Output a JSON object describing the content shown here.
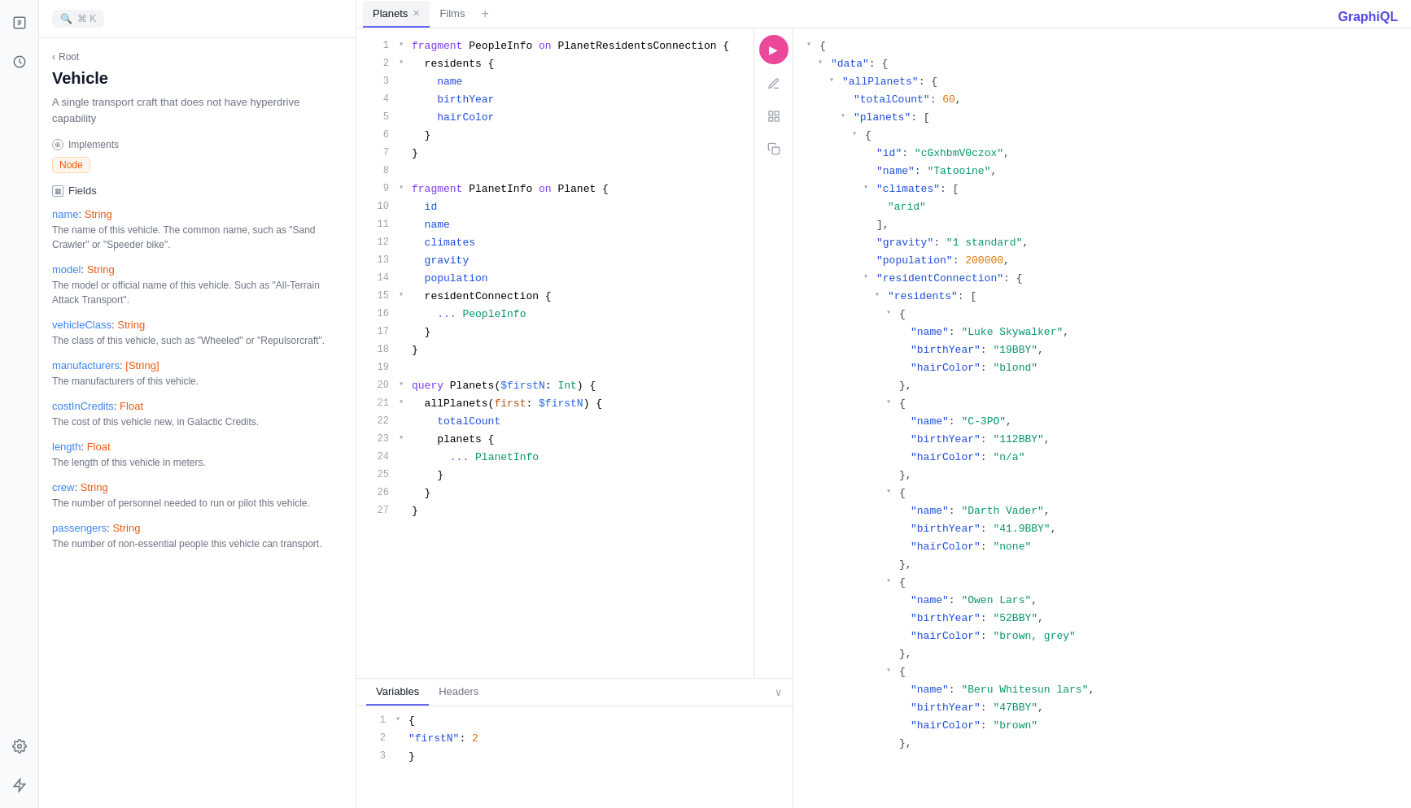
{
  "app": {
    "title": "GraphiQL"
  },
  "leftNav": {
    "icons": [
      "document",
      "history",
      "star",
      "settings"
    ]
  },
  "sidebar": {
    "breadcrumb": "Root",
    "title": "Vehicle",
    "description": "A single transport craft that does not have hyperdrive capability",
    "implements_label": "Implements",
    "search_kbd": "⌘ K",
    "tag": "Node",
    "fields_label": "Fields",
    "fields": [
      {
        "name": "name",
        "type": "String",
        "description": "The name of this vehicle. The common name, such as \"Sand Crawler\" or \"Speeder bike\"."
      },
      {
        "name": "model",
        "type": "String",
        "description": "The model or official name of this vehicle. Such as \"All-Terrain Attack Transport\"."
      },
      {
        "name": "vehicleClass",
        "type": "String",
        "description": "The class of this vehicle, such as \"Wheeled\" or \"Repulsorcraft\"."
      },
      {
        "name": "manufacturers",
        "type": "[String]",
        "description": "The manufacturers of this vehicle."
      },
      {
        "name": "costInCredits",
        "type": "Float",
        "description": "The cost of this vehicle new, in Galactic Credits."
      },
      {
        "name": "length",
        "type": "Float",
        "description": "The length of this vehicle in meters."
      },
      {
        "name": "crew",
        "type": "String",
        "description": "The number of personnel needed to run or pilot this vehicle."
      },
      {
        "name": "passengers",
        "type": "String",
        "description": "The number of non-essential people this vehicle can transport."
      }
    ]
  },
  "tabs": [
    {
      "label": "Planets",
      "active": true,
      "closeable": true
    },
    {
      "label": "Films",
      "active": false,
      "closeable": false
    }
  ],
  "editor": {
    "lines": [
      {
        "num": 1,
        "toggle": "▾",
        "content": "fragment PeopleInfo on PlanetResidentsConnection {",
        "type": "fragment_def"
      },
      {
        "num": 2,
        "toggle": "▾",
        "content": "  residents {",
        "type": "field_open"
      },
      {
        "num": 3,
        "toggle": "",
        "content": "    name",
        "type": "field"
      },
      {
        "num": 4,
        "toggle": "",
        "content": "    birthYear",
        "type": "field"
      },
      {
        "num": 5,
        "toggle": "",
        "content": "    hairColor",
        "type": "field"
      },
      {
        "num": 6,
        "toggle": "",
        "content": "  }",
        "type": "close"
      },
      {
        "num": 7,
        "toggle": "",
        "content": "}",
        "type": "close"
      },
      {
        "num": 8,
        "toggle": "",
        "content": "",
        "type": "blank"
      },
      {
        "num": 9,
        "toggle": "▾",
        "content": "fragment PlanetInfo on Planet {",
        "type": "fragment_def"
      },
      {
        "num": 10,
        "toggle": "",
        "content": "  id",
        "type": "field"
      },
      {
        "num": 11,
        "toggle": "",
        "content": "  name",
        "type": "field"
      },
      {
        "num": 12,
        "toggle": "",
        "content": "  climates",
        "type": "field"
      },
      {
        "num": 13,
        "toggle": "",
        "content": "  gravity",
        "type": "field"
      },
      {
        "num": 14,
        "toggle": "",
        "content": "  population",
        "type": "field"
      },
      {
        "num": 15,
        "toggle": "▾",
        "content": "  residentConnection {",
        "type": "field_open"
      },
      {
        "num": 16,
        "toggle": "",
        "content": "    ... PeopleInfo",
        "type": "spread"
      },
      {
        "num": 17,
        "toggle": "",
        "content": "  }",
        "type": "close"
      },
      {
        "num": 18,
        "toggle": "",
        "content": "}",
        "type": "close"
      },
      {
        "num": 19,
        "toggle": "",
        "content": "",
        "type": "blank"
      },
      {
        "num": 20,
        "toggle": "▾",
        "content": "query Planets($firstN: Int) {",
        "type": "query_def"
      },
      {
        "num": 21,
        "toggle": "▾",
        "content": "  allPlanets(first: $firstN) {",
        "type": "field_open"
      },
      {
        "num": 22,
        "toggle": "",
        "content": "    totalCount",
        "type": "field"
      },
      {
        "num": 23,
        "toggle": "▾",
        "content": "    planets {",
        "type": "field_open"
      },
      {
        "num": 24,
        "toggle": "",
        "content": "      ... PlanetInfo",
        "type": "spread"
      },
      {
        "num": 25,
        "toggle": "",
        "content": "    }",
        "type": "close"
      },
      {
        "num": 26,
        "toggle": "",
        "content": "  }",
        "type": "close"
      },
      {
        "num": 27,
        "toggle": "",
        "content": "}",
        "type": "close"
      }
    ]
  },
  "variables": {
    "tabs": [
      "Variables",
      "Headers"
    ],
    "active_tab": "Variables",
    "lines": [
      {
        "num": 1,
        "toggle": "▾",
        "content": "{"
      },
      {
        "num": 2,
        "toggle": "",
        "content": "  \"firstN\": 2"
      },
      {
        "num": 3,
        "toggle": "",
        "content": "}"
      }
    ]
  },
  "result": {
    "lines": [
      "▾ {",
      "  ▾ \"data\": {",
      "    ▾ \"allPlanets\": {",
      "        \"totalCount\": 60,",
      "      ▾ \"planets\": [",
      "        ▾ {",
      "            \"id\": \"cGxhbmV0czox\",",
      "            \"name\": \"Tatooine\",",
      "          ▾ \"climates\": [",
      "              \"arid\"",
      "            ],",
      "            \"gravity\": \"1 standard\",",
      "            \"population\": 200000,",
      "          ▾ \"residentConnection\": {",
      "            ▾ \"residents\": [",
      "              ▾ {",
      "                  \"name\": \"Luke Skywalker\",",
      "                  \"birthYear\": \"19BBY\",",
      "                  \"hairColor\": \"blond\"",
      "                },",
      "              ▾ {",
      "                  \"name\": \"C-3PO\",",
      "                  \"birthYear\": \"112BBY\",",
      "                  \"hairColor\": \"n/a\"",
      "                },",
      "              ▾ {",
      "                  \"name\": \"Darth Vader\",",
      "                  \"birthYear\": \"41.9BBY\",",
      "                  \"hairColor\": \"none\"",
      "                },",
      "              ▾ {",
      "                  \"name\": \"Owen Lars\",",
      "                  \"birthYear\": \"52BBY\",",
      "                  \"hairColor\": \"brown, grey\"",
      "                },",
      "              ▾ {",
      "                  \"name\": \"Beru Whitesun lars\",",
      "                  \"birthYear\": \"47BBY\",",
      "                  \"hairColor\": \"brown\"",
      "                },"
    ]
  }
}
